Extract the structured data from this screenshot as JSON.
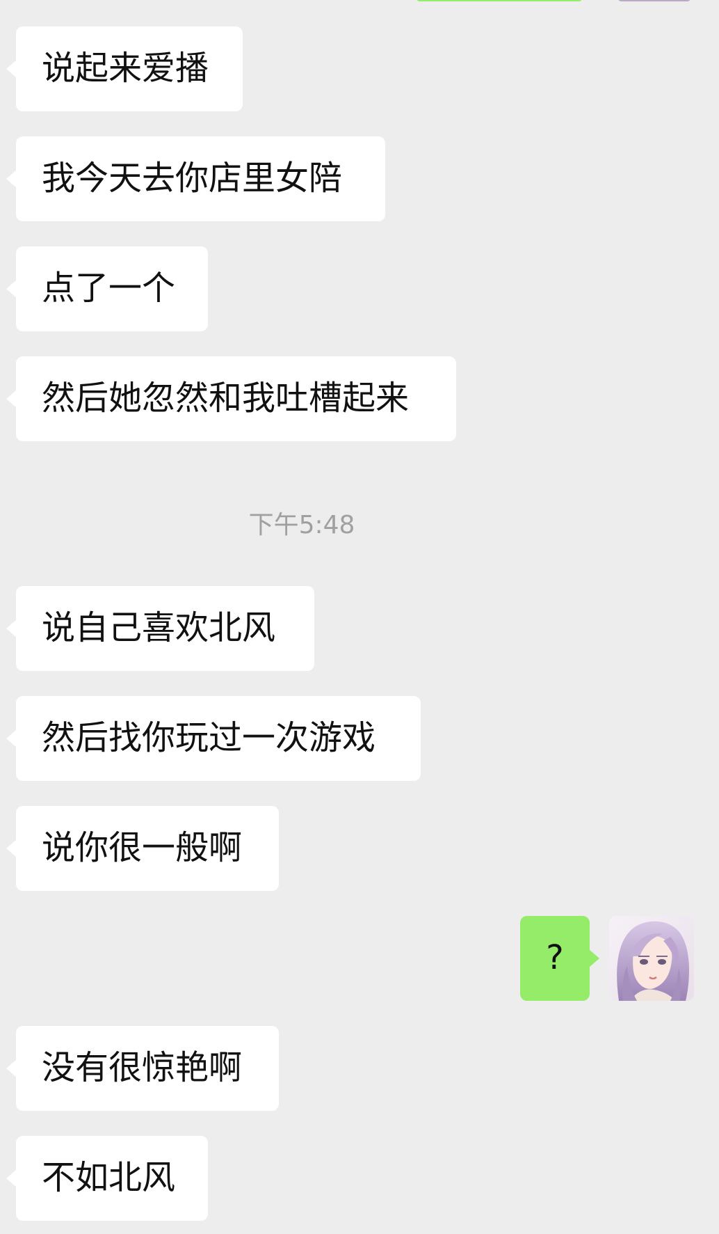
{
  "chat": {
    "messages_before": [
      "说起来爱播",
      "我今天去你店里女陪",
      "点了一个",
      "然后她忽然和我吐槽起来"
    ],
    "timestamp": "下午5:48",
    "messages_after": [
      "说自己喜欢北风",
      "然后找你玩过一次游戏",
      "说你很一般啊"
    ],
    "outgoing": "?",
    "messages_final": [
      "没有很惊艳啊",
      "不如北风"
    ]
  },
  "colors": {
    "background": "#ededed",
    "incoming_bubble": "#ffffff",
    "outgoing_bubble": "#95ec69",
    "timestamp_text": "#a0a0a0"
  },
  "icons": {
    "avatar": "anime-avatar-lavender-hair"
  }
}
